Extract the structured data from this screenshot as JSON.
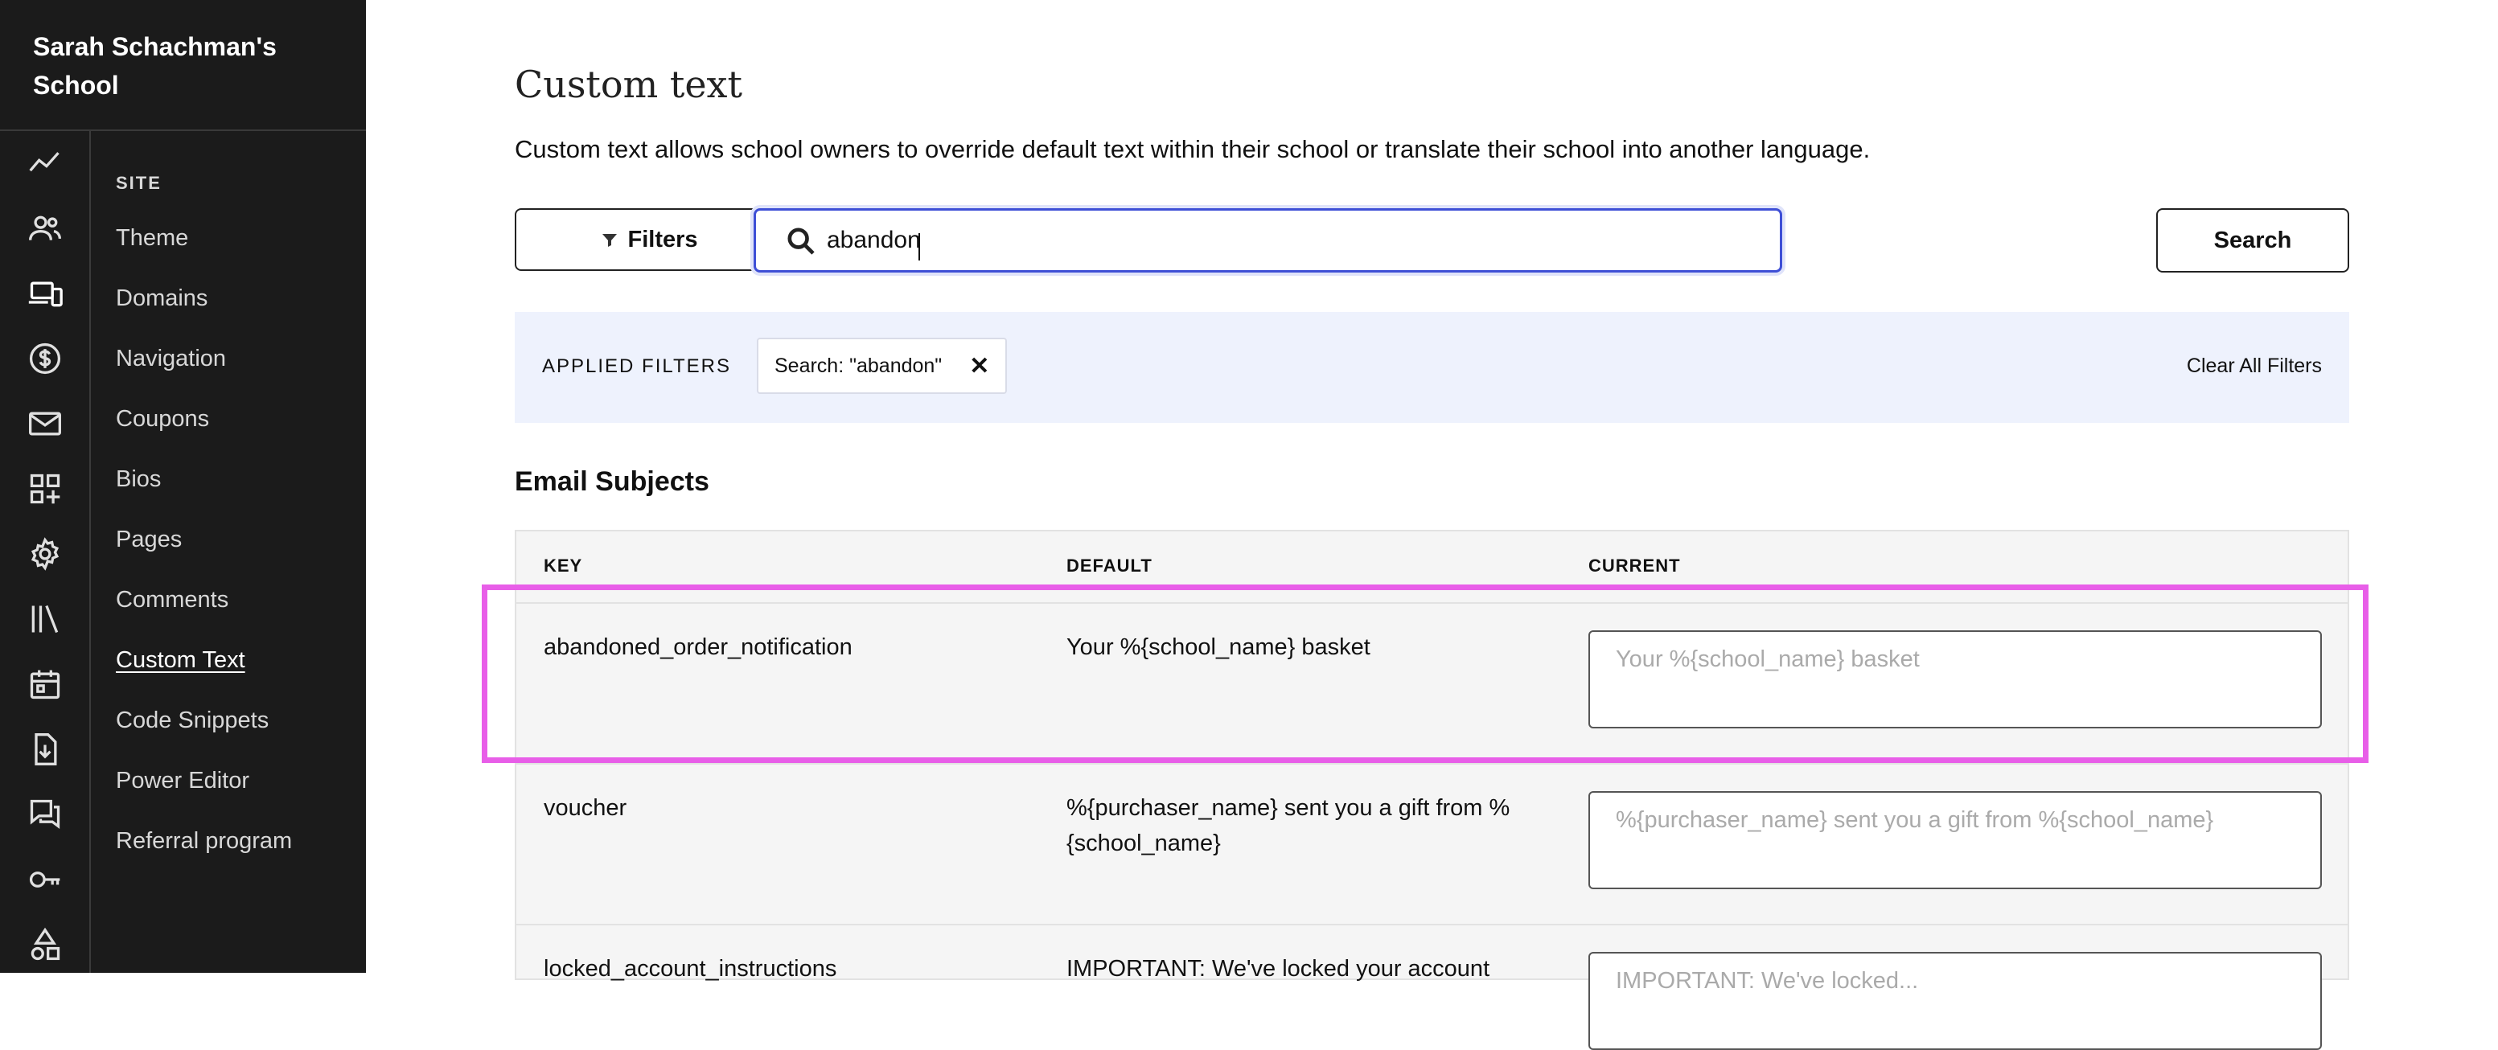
{
  "sidebar": {
    "school_name": "Sarah Schachman's School",
    "section_label": "SITE",
    "rail_icons": [
      "analytics-icon",
      "users-icon",
      "devices-icon",
      "dollar-icon",
      "mail-icon",
      "apps-add-icon",
      "gear-icon",
      "library-icon",
      "calendar-icon",
      "download-icon",
      "chat-icon",
      "key-icon",
      "shapes-icon"
    ],
    "items": [
      {
        "label": "Theme"
      },
      {
        "label": "Domains"
      },
      {
        "label": "Navigation"
      },
      {
        "label": "Coupons"
      },
      {
        "label": "Bios"
      },
      {
        "label": "Pages"
      },
      {
        "label": "Comments"
      },
      {
        "label": "Custom Text",
        "active": true
      },
      {
        "label": "Code Snippets"
      },
      {
        "label": "Power Editor"
      },
      {
        "label": "Referral program"
      }
    ]
  },
  "main": {
    "title": "Custom text",
    "description": "Custom text allows school owners to override default text within their school or translate their school into another language.",
    "filters_label": "Filters",
    "search_value": "abandon",
    "search_button": "Search",
    "applied_filters_label": "APPLIED FILTERS",
    "filter_chip": "Search: \"abandon\"",
    "chip_close": "✕",
    "clear_all": "Clear All Filters",
    "section_title": "Email Subjects",
    "table": {
      "headers": {
        "key": "KEY",
        "default": "DEFAULT",
        "current": "CURRENT"
      },
      "rows": [
        {
          "key": "abandoned_order_notification",
          "default": "Your %{school_name} basket",
          "current_placeholder": "Your %{school_name} basket"
        },
        {
          "key": "voucher",
          "default": "%{purchaser_name} sent you a gift from %{school_name}",
          "current_placeholder": "%{purchaser_name} sent you a gift from %{school_name}"
        },
        {
          "key": "locked_account_instructions",
          "default": "IMPORTANT: We've locked your account",
          "current_placeholder": "IMPORTANT: We've locked..."
        }
      ]
    }
  },
  "colors": {
    "sidebar_bg": "#1b1b1b",
    "accent": "#3e4fd6",
    "filters_bar_bg": "#eef2fd",
    "highlight": "#e85ee8"
  }
}
